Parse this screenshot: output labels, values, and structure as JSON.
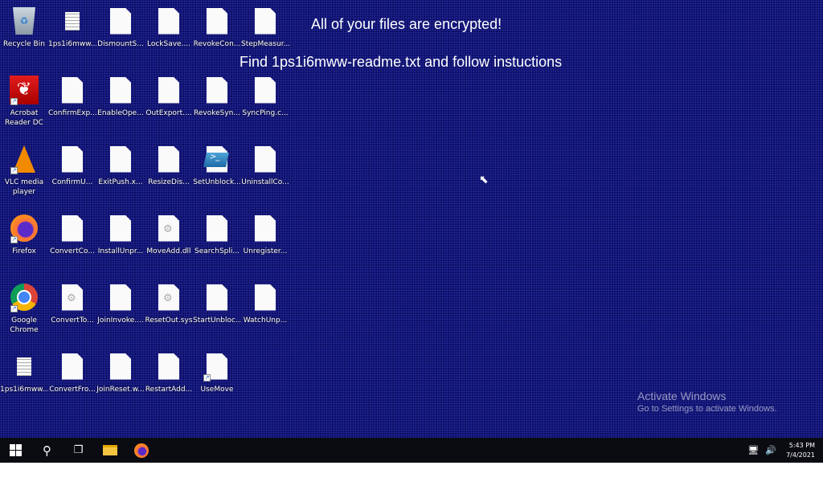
{
  "desktop": {
    "message_title": "All of your files are encrypted!",
    "message_instruction": "Find 1ps1i6mww-readme.txt and follow instuctions",
    "watermark_title": "Activate Windows",
    "watermark_subtitle": "Go to Settings to activate Windows.",
    "icons": [
      [
        {
          "label": "Recycle Bin",
          "type": "recycle-bin"
        },
        {
          "label": "1ps1i6mww...",
          "type": "text"
        },
        {
          "label": "DismountS...",
          "type": "blank"
        },
        {
          "label": "LockSave....",
          "type": "blank"
        },
        {
          "label": "RevokeCon...",
          "type": "blank"
        },
        {
          "label": "StepMeasur...",
          "type": "blank"
        }
      ],
      [
        {
          "label": "Acrobat Reader DC",
          "type": "acrobat",
          "shortcut": true
        },
        {
          "label": "ConfirmExp...",
          "type": "blank"
        },
        {
          "label": "EnableOpe...",
          "type": "blank"
        },
        {
          "label": "OutExport....",
          "type": "blank"
        },
        {
          "label": "RevokeSyn...",
          "type": "blank"
        },
        {
          "label": "SyncPing.c...",
          "type": "blank"
        }
      ],
      [
        {
          "label": "VLC media player",
          "type": "vlc",
          "shortcut": true
        },
        {
          "label": "ConfirmU...",
          "type": "blank"
        },
        {
          "label": "ExitPush.x...",
          "type": "blank"
        },
        {
          "label": "ResizeDis...",
          "type": "blank"
        },
        {
          "label": "SetUnblock...",
          "type": "powershell"
        },
        {
          "label": "UninstallCo...",
          "type": "blank"
        }
      ],
      [
        {
          "label": "Firefox",
          "type": "firefox",
          "shortcut": true
        },
        {
          "label": "ConvertCo...",
          "type": "blank"
        },
        {
          "label": "InstallUnpr...",
          "type": "blank"
        },
        {
          "label": "MoveAdd.dll",
          "type": "gear"
        },
        {
          "label": "SearchSpli...",
          "type": "blank"
        },
        {
          "label": "Unregister...",
          "type": "blank"
        }
      ],
      [
        {
          "label": "Google Chrome",
          "type": "chrome",
          "shortcut": true
        },
        {
          "label": "ConvertTo...",
          "type": "gear"
        },
        {
          "label": "JoinInvoke....",
          "type": "blank"
        },
        {
          "label": "ResetOut.sys",
          "type": "gear"
        },
        {
          "label": "StartUnbloc...",
          "type": "blank"
        },
        {
          "label": "WatchUnp...",
          "type": "blank"
        }
      ],
      [
        {
          "label": "1ps1i6mww...",
          "type": "text"
        },
        {
          "label": "ConvertFro...",
          "type": "blank"
        },
        {
          "label": "JoinReset.w...",
          "type": "blank"
        },
        {
          "label": "RestartAdd...",
          "type": "blank"
        },
        {
          "label": "UseMove",
          "type": "blank",
          "shortcut": true
        }
      ]
    ]
  },
  "taskbar": {
    "items": [
      "start",
      "search",
      "task-view",
      "file-explorer",
      "firefox"
    ],
    "time": "5:43 PM",
    "date": "7/4/2021"
  }
}
